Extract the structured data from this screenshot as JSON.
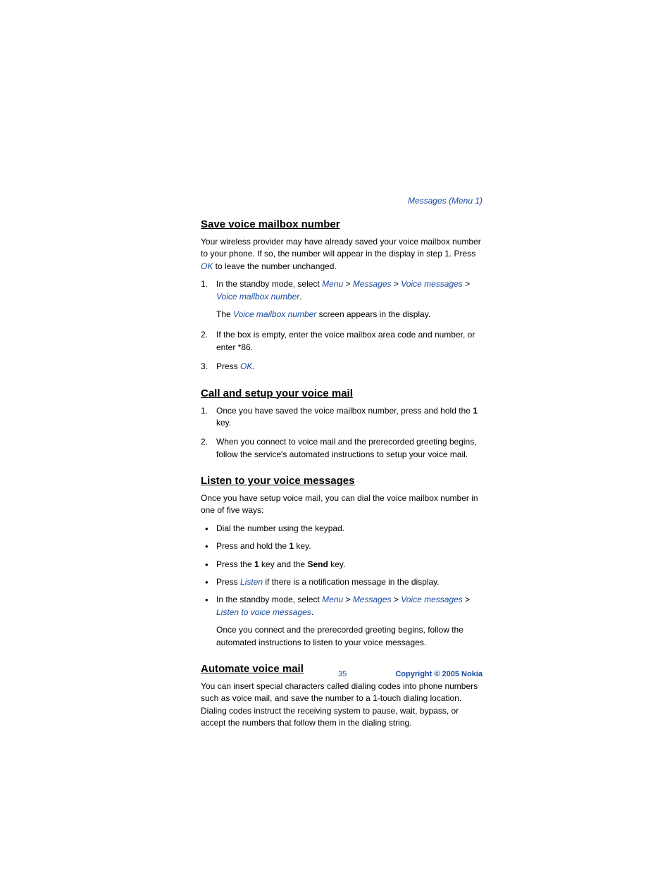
{
  "header": {
    "breadcrumb": "Messages (Menu 1)"
  },
  "sections": {
    "save": {
      "title": "Save voice mailbox number",
      "intro_a": "Your wireless provider may have already saved your voice mailbox number to your phone. If so, the number will appear in the display in step 1. Press ",
      "intro_ok": "OK",
      "intro_b": " to leave the number unchanged.",
      "step1_a": "In the standby mode, select ",
      "menu": "Menu",
      "messages": "Messages",
      "voice_messages": "Voice messages",
      "voice_mailbox_number": "Voice mailbox number",
      "gt": " > ",
      "period": ".",
      "step1_sub_a": "The ",
      "step1_sub_term": "Voice mailbox number",
      "step1_sub_b": " screen appears in the display.",
      "step2": "If the box is empty, enter the voice mailbox area code and number, or enter *86.",
      "step3_a": "Press ",
      "step3_ok": "OK"
    },
    "call": {
      "title": "Call and setup your voice mail",
      "step1_a": "Once you have saved the voice mailbox number, press and hold the ",
      "step1_key": "1",
      "step1_b": " key.",
      "step2": "When you connect to voice mail and the prerecorded greeting begins, follow the service's automated instructions to setup your voice mail."
    },
    "listen": {
      "title": "Listen to your voice messages",
      "intro": "Once you have setup voice mail, you can dial the voice mailbox number in one of five ways:",
      "b1": "Dial the number using the keypad.",
      "b2_a": "Press and hold the ",
      "b2_key": "1",
      "b2_b": " key.",
      "b3_a": "Press the ",
      "b3_key1": "1",
      "b3_mid": " key and the ",
      "b3_key2": "Send",
      "b3_b": " key.",
      "b4_a": "Press ",
      "b4_listen": "Listen",
      "b4_b": " if there is a notification message in the display.",
      "b5_a": "In the standby mode, select ",
      "b5_listen": "Listen to voice messages",
      "b5_sub": "Once you connect and the prerecorded greeting begins, follow the automated instructions to listen to your voice messages."
    },
    "automate": {
      "title": "Automate voice mail",
      "intro": "You can insert special characters called dialing codes into phone numbers such as voice mail, and save the number to a 1-touch dialing location. Dialing codes instruct the receiving system to pause, wait, bypass, or accept the numbers that follow them in the dialing string."
    }
  },
  "footer": {
    "page": "35",
    "copyright": "Copyright © 2005 Nokia"
  }
}
